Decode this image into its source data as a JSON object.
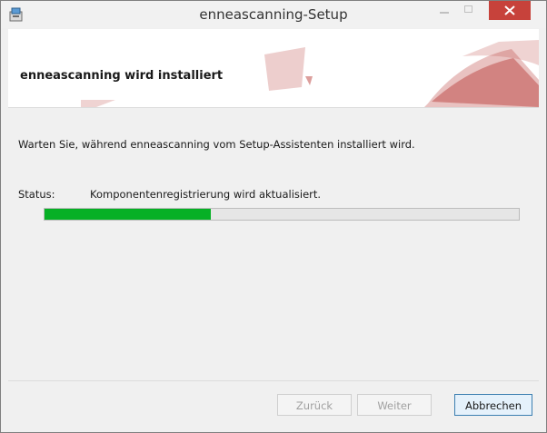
{
  "window": {
    "title": "enneascanning-Setup"
  },
  "header": {
    "title": "enneascanning wird installiert"
  },
  "body": {
    "description": "Warten Sie, während enneascanning vom Setup-Assistenten installiert wird.",
    "status_label": "Status:",
    "status_value": "Komponentenregistrierung wird aktualisiert.",
    "progress_fraction": 0.35
  },
  "footer": {
    "back_label": "Zurück",
    "next_label": "Weiter",
    "cancel_label": "Abbrechen"
  },
  "colors": {
    "progress_fill": "#06b025",
    "close_button": "#c7423b",
    "decor_red": "#c0504d"
  },
  "icons": {
    "app": "installer-icon",
    "minimize": "minimize-icon",
    "maximize": "maximize-icon",
    "close": "close-icon"
  }
}
